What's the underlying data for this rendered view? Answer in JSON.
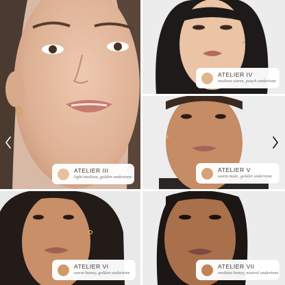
{
  "gallery": {
    "tiles": [
      {
        "shade": "ATELIER III",
        "description": "light medium, golden undertone",
        "swatch_color": "#e6c29a"
      },
      {
        "shade": "ATELIER IV",
        "description": "medium warm, peach undertone",
        "swatch_color": "#e0b58d"
      },
      {
        "shade": "ATELIER V",
        "description": "warm nude, golden undertone",
        "swatch_color": "#d6a27a"
      },
      {
        "shade": "ATELIER VI",
        "description": "warm honey, golden undertone",
        "swatch_color": "#cf9a68"
      },
      {
        "shade": "ATELIER VII",
        "description": "medium honey, neutral undertone",
        "swatch_color": "#c08456"
      }
    ],
    "nav": {
      "prev_icon": "chevron-left-icon",
      "next_icon": "chevron-right-icon"
    }
  }
}
